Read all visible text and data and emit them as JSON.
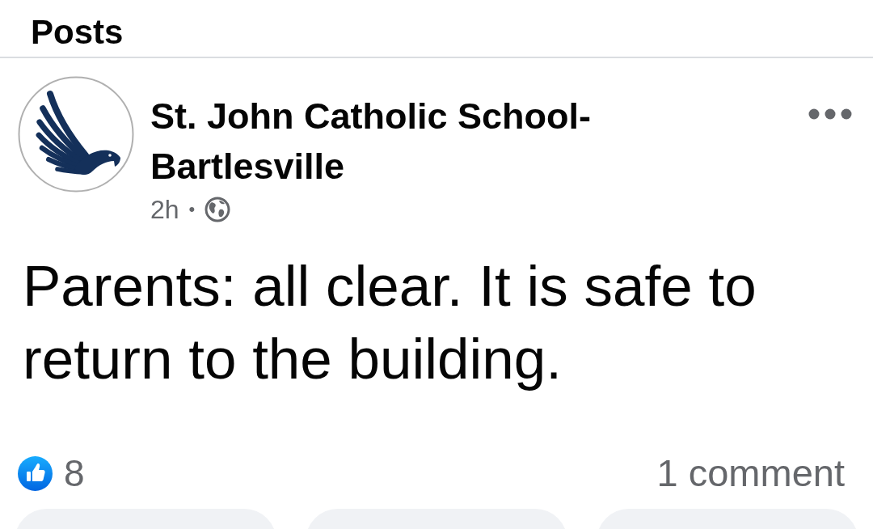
{
  "header": {
    "title": "Posts"
  },
  "post": {
    "author": "St. John Catholic School-Bartlesville",
    "time": "2h",
    "separator": "•",
    "public": true,
    "body": "Parents: all clear. It is safe to return to the building.",
    "reaction_count": "8",
    "comment_count": "1 comment"
  }
}
